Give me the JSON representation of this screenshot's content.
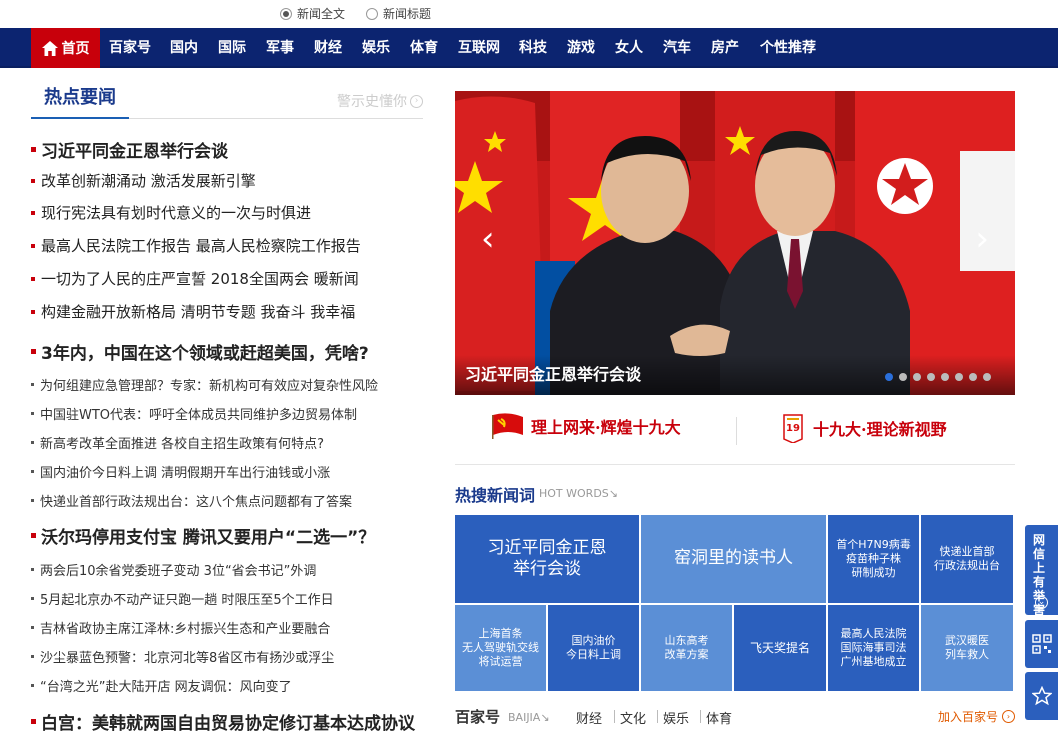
{
  "search_scope": {
    "options": [
      {
        "label": "新闻全文",
        "checked": true
      },
      {
        "label": "新闻标题",
        "checked": false
      }
    ]
  },
  "nav": {
    "home": "首页",
    "items": [
      "百家号",
      "国内",
      "国际",
      "军事",
      "财经",
      "娱乐",
      "体育",
      "互联网",
      "科技",
      "游戏",
      "女人",
      "汽车",
      "房产",
      "个性推荐"
    ]
  },
  "hot_news": {
    "title": "热点要闻",
    "slogan": "警示史懂你",
    "items": [
      "习近平同金正恩举行会谈",
      "改革创新潮涌动 激活发展新引擎",
      "现行宪法具有划时代意义的一次与时俱进",
      "最高人民法院工作报告 最高人民检察院工作报告",
      "一切为了人民的庄严宣誓 2018全国两会  暖新闻",
      "构建金融开放新格局  清明节专题  我奋斗 我幸福",
      "3年内，中国在这个领域或赶超美国，凭啥?",
      "为何组建应急管理部？专家：新机构可有效应对复杂性风险",
      "中国驻WTO代表：呼吁全体成员共同维护多边贸易体制",
      "新高考改革全面推进 各校自主招生政策有何特点?",
      "国内油价今日料上调 清明假期开车出行油钱或小涨",
      "快递业首部行政法规出台：这八个焦点问题都有了答案",
      "沃尔玛停用支付宝 腾讯又要用户“二选一”？",
      "两会后10余省党委班子变动 3位“省会书记”外调",
      "5月起北京办不动产证只跑一趟 时限压至5个工作日",
      "吉林省政协主席江泽林:乡村振兴生态和产业要融合",
      "沙尘暴蓝色预警：北京河北等8省区市有扬沙或浮尘",
      "“台湾之光”赴大陆开店 网友调侃：风向变了",
      "白宫：美韩就两国自由贸易协定修订基本达成协议"
    ]
  },
  "slider": {
    "caption": "习近平同金正恩举行会谈",
    "prev": "‹",
    "next": "›",
    "total": 8,
    "active": 1,
    "colors": {
      "flag_red": "#d01c1c",
      "prc_red": "#de2910",
      "dprk_blue": "#024fa2",
      "star": "#ffde00"
    }
  },
  "banners": {
    "left": "理上网来·辉煌十九大",
    "right": "十九大·理论新视野"
  },
  "hot_words": {
    "title": "热搜新闻词",
    "subtitle": "HOT WORDS↘",
    "tiles": [
      "习近平同金正恩\n举行会谈",
      "窑洞里的读书人",
      "首个H7N9病毒\n疫苗种子株\n研制成功",
      "快递业首部\n行政法规出台",
      "上海首条\n无人驾驶轨交线\n将试运营",
      "国内油价\n今日料上调",
      "山东高考\n改革方案",
      "飞天奖提名",
      "最高人民法院\n国际海事司法\n广州基地成立",
      "武汉暖医\n列车救人"
    ]
  },
  "baijia": {
    "title": "百家号",
    "subtitle": "BAIJIA↘",
    "links": [
      "财经",
      "文化",
      "娱乐",
      "体育"
    ],
    "join": "加入百家号"
  },
  "side_tool": {
    "report_label": "网信上有举害报",
    "qr_label": "二维码",
    "star_label": "收藏"
  },
  "colors": {
    "nav_bg": "#0c2470",
    "home_red": "#c8000b",
    "accent_blue": "#1a3a8c",
    "tile_dark": "#2b5fbd",
    "tile_light": "#5b8fd6"
  }
}
